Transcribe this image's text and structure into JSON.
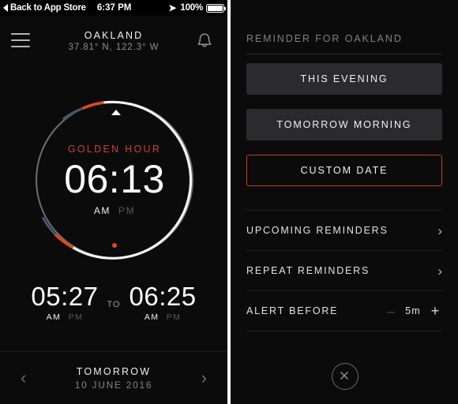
{
  "status_bar": {
    "back_label": "Back to App Store",
    "back_icon": "back-triangle-icon",
    "time": "6:37 PM",
    "location_icon": "location-arrow-icon",
    "battery_percent": "100%",
    "battery_icon": "battery-full-icon"
  },
  "left_panel": {
    "menu_icon": "hamburger-menu-icon",
    "bell_icon": "bell-icon",
    "city": "OAKLAND",
    "coords": "37.81° N, 122.3° W",
    "dial": {
      "event_label": "GOLDEN HOUR",
      "time": "06:13",
      "am": "AM",
      "pm": "PM",
      "marker_icon": "dial-marker-triangle-icon",
      "dot_icon": "dial-dot-icon"
    },
    "range": {
      "start_time": "05:27",
      "start_am": "AM",
      "start_pm": "PM",
      "separator": "TO",
      "end_time": "06:25",
      "end_am": "AM",
      "end_pm": "PM"
    },
    "footer": {
      "prev_icon": "chevron-left-icon",
      "next_icon": "chevron-right-icon",
      "day_label": "TOMORROW",
      "date_label": "10 JUNE 2016"
    }
  },
  "right_panel": {
    "title": "REMINDER FOR OAKLAND",
    "buttons": [
      {
        "label": "THIS EVENING",
        "style": "filled"
      },
      {
        "label": "TOMORROW MORNING",
        "style": "filled"
      },
      {
        "label": "CUSTOM DATE",
        "style": "outlined"
      }
    ],
    "rows": [
      {
        "label": "UPCOMING REMINDERS",
        "chevron": "›"
      },
      {
        "label": "REPEAT REMINDERS",
        "chevron": "›"
      }
    ],
    "alert_before": {
      "label": "ALERT BEFORE",
      "minus": "–",
      "value": "5m",
      "plus": "+"
    },
    "close_icon": "close-circle-icon"
  },
  "colors": {
    "accent_red": "#c7391c",
    "golden": "#c9452a",
    "dial_white": "#f5f5f5",
    "dial_blue": "#46566b",
    "dial_orange": "#e0481f",
    "background": "#0b0b0c",
    "button_fill": "#2b2b2d"
  }
}
